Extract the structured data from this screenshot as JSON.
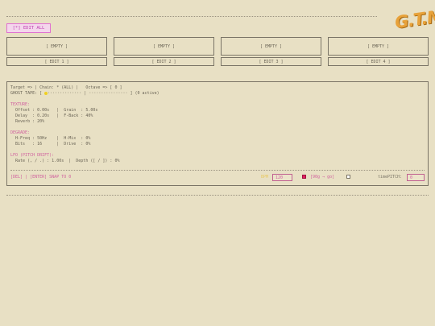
{
  "logo_text": "G.T.M",
  "edit_all_label": "[*] EDIT ALL",
  "slots": [
    {
      "slot_label": "[ EMPTY ]",
      "edit_label": "[ EDIT 1 ]"
    },
    {
      "slot_label": "[ EMPTY ]",
      "edit_label": "[ EDIT 2 ]"
    },
    {
      "slot_label": "[ EMPTY ]",
      "edit_label": "[ EDIT 3 ]"
    },
    {
      "slot_label": "[ EMPTY ]",
      "edit_label": "[ EDIT 4 ]"
    }
  ],
  "panel": {
    "target_line": "Target => | Chain: * (ALL) |   Octave => [ 0 ]",
    "ghost_tape_prefix": "GHOST TAPE: [ ",
    "ghost_tape_suffix": "·············· | ················ ] (0 active)",
    "texture_header": "TEXTURE:",
    "texture_line1": "  Offset : 0.00s   |  Grain  : 5.00s",
    "texture_line2": "  Delay  : 0.20s   |  F-Back : 40%",
    "texture_line3": "  Reverb : 20%",
    "degrade_header": "DEGRADE:",
    "degrade_line1": "  H-Freq : 50Hz    |  H-Mix  : 0%",
    "degrade_line2": "  Bits   : 16      |  Drive  : 0%",
    "lfo_header": "LFO (PITCH DRIFT):",
    "lfo_line1": "  Rate (, / .) : 1.00s  |  Depth ([ / ]) : 0%",
    "help_text": "[DEL]  |  [ENTER] SNAP TO 0",
    "bpm_label": "BPM",
    "bpm_value": "120",
    "sync_label": "[90g → go]",
    "sync_checked": true,
    "second_checkbox_checked": false,
    "timepitch_label": "timePITCH:",
    "timepitch_value": "0"
  }
}
